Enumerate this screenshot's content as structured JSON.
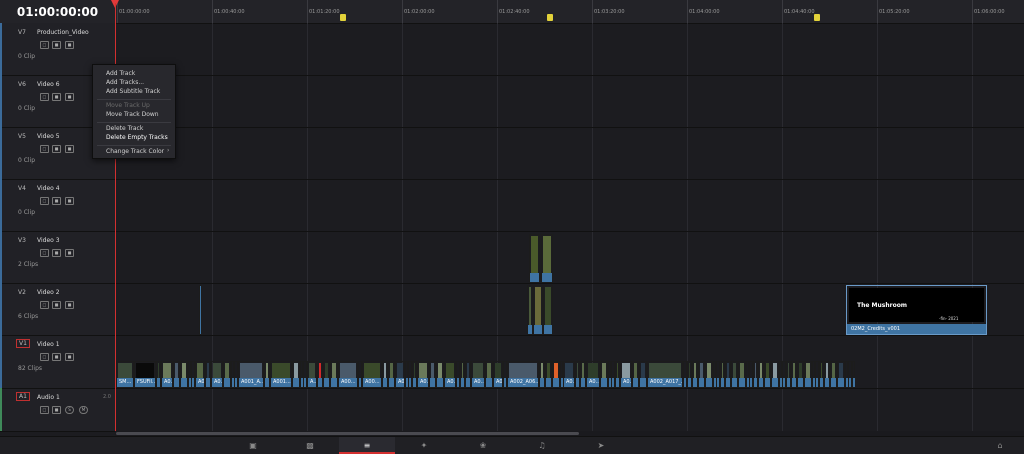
{
  "timecode": "01:00:00:00",
  "ruler": {
    "labels": [
      "01:00:00:00",
      "01:00:40:00",
      "01:01:20:00",
      "01:02:00:00",
      "01:02:40:00",
      "01:03:20:00",
      "01:04:00:00",
      "01:04:40:00",
      "01:05:20:00",
      "01:06:00:00"
    ],
    "marker_color": "#e2d23a"
  },
  "tracks": [
    {
      "id": "V7",
      "name": "Production_Video",
      "clips": "0 Clip"
    },
    {
      "id": "V6",
      "name": "Video 6",
      "clips": "0 Clip"
    },
    {
      "id": "V5",
      "name": "Video 5",
      "clips": "0 Clip"
    },
    {
      "id": "V4",
      "name": "Video 4",
      "clips": "0 Clip"
    },
    {
      "id": "V3",
      "name": "Video 3",
      "clips": "2 Clips"
    },
    {
      "id": "V2",
      "name": "Video 2",
      "clips": "6 Clips"
    },
    {
      "id": "V1",
      "name": "Video 1",
      "clips": "82 Clips"
    },
    {
      "id": "A1",
      "name": "Audio 1",
      "level": "2.0"
    }
  ],
  "audio_buttons": {
    "solo": "S",
    "mute": "M"
  },
  "context_menu": {
    "items": [
      {
        "label": "Add Track",
        "enabled": true
      },
      {
        "label": "Add Tracks...",
        "enabled": true
      },
      {
        "label": "Add Subtitle Track",
        "enabled": true
      },
      {
        "label": "Move Track Up",
        "enabled": false
      },
      {
        "label": "Move Track Down",
        "enabled": true
      },
      {
        "label": "Delete Track",
        "enabled": true
      },
      {
        "label": "Delete Empty Tracks",
        "enabled": true
      },
      {
        "label": "Change Track Color",
        "enabled": true
      }
    ]
  },
  "v1_clip_labels": [
    "SM...",
    "FSUFil...",
    "A0...",
    "A0...",
    "A0...",
    "A001_A...",
    "A001...",
    "A...",
    "A00...",
    "A00...",
    "A0...",
    "A0...",
    "A0...",
    "A0...",
    "A0...",
    "A002_A06...",
    "A0...",
    "A0...",
    "A0...",
    "A002_A017_..."
  ],
  "credits_clip": {
    "name": "02M2_Credits_v001",
    "title": "The Mushroom",
    "subtitle": "-fin- 2021"
  },
  "pages": [
    "media-icon",
    "cut-icon",
    "edit-icon",
    "fusion-icon",
    "color-icon",
    "fairlight-icon",
    "deliver-icon"
  ],
  "accent_color": "#3f74a3",
  "playhead_color": "#d33030"
}
